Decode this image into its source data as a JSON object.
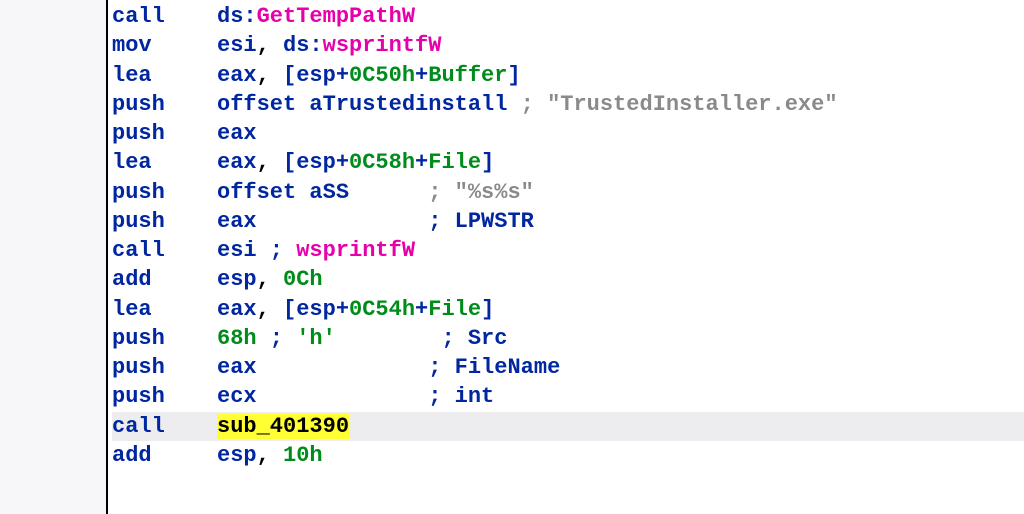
{
  "lines": [
    {
      "mn": "call",
      "op_pre": "ds:",
      "op_fn": "GetTempPathW"
    },
    {
      "mn": "mov",
      "r1": "esi",
      "r2": "ds:",
      "fn": "wsprintfW"
    },
    {
      "mn": "lea",
      "r1": "eax",
      "br": "[",
      "r2": "esp",
      "plus": "+",
      "off": "0C50h",
      "plus2": "+",
      "name": "Buffer",
      "brc": "]"
    },
    {
      "mn": "push",
      "kw": "offset",
      "id": "aTrustedinstall",
      "comment": "; \"TrustedInstaller.exe\""
    },
    {
      "mn": "push",
      "r1": "eax"
    },
    {
      "mn": "lea",
      "r1": "eax",
      "br": "[",
      "r2": "esp",
      "plus": "+",
      "off": "0C58h",
      "plus2": "+",
      "name": "File",
      "brc": "]"
    },
    {
      "mn": "push",
      "kw": "offset",
      "id": "aSS",
      "pad": "      ",
      "comment": "; \"%s%s\""
    },
    {
      "mn": "push",
      "r1": "eax",
      "pad": "             ",
      "comment": "; LPWSTR"
    },
    {
      "mn": "call",
      "r1": "esi",
      "semi": " ; ",
      "fn": "wsprintfW"
    },
    {
      "mn": "add",
      "r1": "esp",
      "num": "0Ch"
    },
    {
      "mn": "lea",
      "r1": "eax",
      "br": "[",
      "r2": "esp",
      "plus": "+",
      "off": "0C54h",
      "plus2": "+",
      "name": "File",
      "brc": "]"
    },
    {
      "mn": "push",
      "num": "68h",
      "semi": " ; ",
      "chr": "'h'",
      "pad": "        ",
      "comment": "; Src"
    },
    {
      "mn": "push",
      "r1": "eax",
      "pad": "             ",
      "comment": "; FileName"
    },
    {
      "mn": "push",
      "r1": "ecx",
      "pad": "             ",
      "comment": "; int"
    },
    {
      "mn": "call",
      "sub": "sub_401390",
      "hl": true
    },
    {
      "mn": "add",
      "r1": "esp",
      "num": "10h"
    }
  ]
}
